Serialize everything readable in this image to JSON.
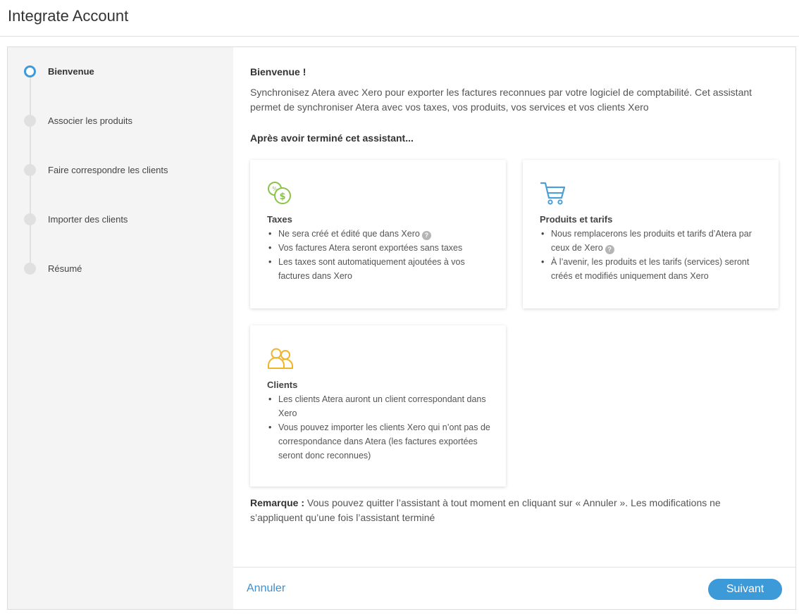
{
  "header": {
    "title": "Integrate Account"
  },
  "steps": [
    {
      "label": "Bienvenue",
      "active": true
    },
    {
      "label": "Associer les produits",
      "active": false
    },
    {
      "label": "Faire correspondre les clients",
      "active": false
    },
    {
      "label": "Importer des clients",
      "active": false
    },
    {
      "label": "Résumé",
      "active": false
    }
  ],
  "main": {
    "welcome_title": "Bienvenue !",
    "intro": "Synchronisez Atera avec Xero pour exporter les factures reconnues par votre logiciel de comptabilité. Cet assistant permet de synchroniser Atera avec vos taxes, vos produits, vos services et vos clients Xero",
    "after_title": "Après avoir terminé cet assistant...",
    "cards": [
      {
        "icon": "taxes-icon",
        "title": "Taxes",
        "items": [
          "Ne sera créé et édité que dans Xero",
          "Vos factures Atera seront exportées sans taxes",
          "Les taxes sont automatiquement ajoutées à vos factures dans Xero"
        ]
      },
      {
        "icon": "shopping-cart-icon",
        "title": "Produits et tarifs",
        "items": [
          "Nous remplacerons les produits et tarifs d’Atera par ceux de Xero",
          "À l’avenir, les produits et les tarifs (services) seront créés et modifiés uniquement dans Xero"
        ]
      },
      {
        "icon": "users-icon",
        "title": "Clients",
        "items": [
          "Les clients Atera auront un client correspondant dans Xero",
          "Vous pouvez importer les clients Xero qui n’ont pas de correspondance dans Atera (les factures exportées seront donc reconnues)"
        ]
      }
    ],
    "help_glyph": "?",
    "note_label": "Remarque :",
    "note_text": " Vous pouvez quitter l’assistant à tout moment en cliquant sur « Annuler ». Les modifications ne s’appliquent qu’une fois l’assistant terminé"
  },
  "footer": {
    "cancel_label": "Annuler",
    "next_label": "Suivant"
  },
  "colors": {
    "accent": "#3d9ad9",
    "taxes_icon": "#8bc34a",
    "cart_icon": "#4a9fd8",
    "clients_icon": "#f0b429"
  }
}
